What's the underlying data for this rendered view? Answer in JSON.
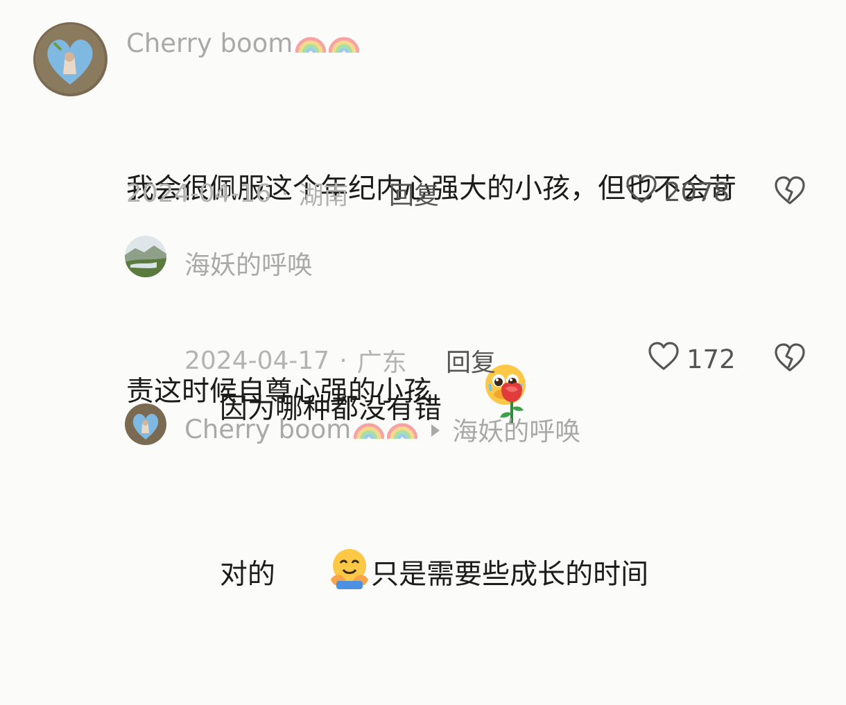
{
  "comments": [
    {
      "username": "Cherry boom",
      "text_1": "我会很佩服这个年纪内心强大的小孩，但也不会苛",
      "text_2": "责这时候自尊心强的小孩",
      "emoji": "pleading-face-hands-over-mouth",
      "date": "2024-04-16",
      "location": "湖南",
      "reply_label": "回复",
      "likes": "2078"
    },
    {
      "username": "海妖的呼唤",
      "text": "因为哪种都没有错",
      "emoji": "rose",
      "date": "2024-04-17",
      "location": "广东",
      "reply_label": "回复",
      "likes": "172"
    },
    {
      "username": "Cherry boom",
      "reply_to": "海妖的呼唤",
      "text_a": "对的",
      "text_b": "只是需要些成长的时间",
      "emoji": "hugging-face"
    }
  ],
  "colors": {
    "background": "#fbfbf9",
    "username": "#a9a9a9",
    "text": "#1c1c1c",
    "meta": "#b3b3b3"
  }
}
